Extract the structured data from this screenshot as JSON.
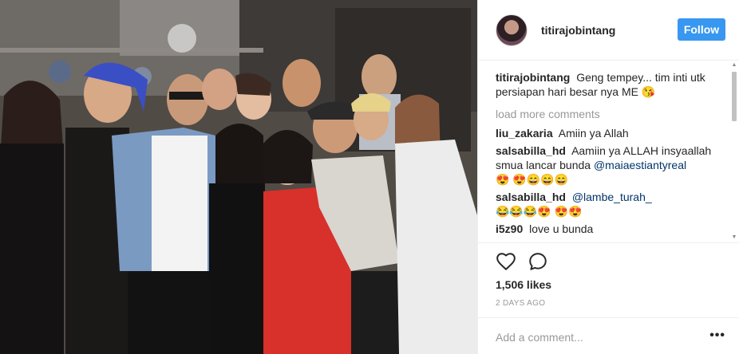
{
  "photo": {
    "description_icon": "group-photo"
  },
  "header": {
    "username": "titirajobintang",
    "follow_label": "Follow",
    "accent": "#3897f0"
  },
  "caption": {
    "user": "titirajobintang",
    "text": "Geng tempey... tim inti utk persiapan hari besar nya ME 😘"
  },
  "load_more": "load more comments",
  "comments": [
    {
      "user": "liu_zakaria",
      "text": "Amiin ya Allah",
      "mention": "",
      "emoji": ""
    },
    {
      "user": "salsabilla_hd",
      "text": "Aamiin ya ALLAH insyaallah smua lancar bunda",
      "mention": "@maiaestiantyreal",
      "emoji": "😍 😍😄😄😄"
    },
    {
      "user": "salsabilla_hd",
      "text": "",
      "mention": "@lambe_turah_",
      "emoji": "😂😂😂😍 😍😍"
    },
    {
      "user": "i5z90",
      "text": "love u bunda",
      "mention": "",
      "emoji": ""
    }
  ],
  "likes": "1,506 likes",
  "date": "2 DAYS AGO",
  "add_comment_placeholder": "Add a comment...",
  "more_label": "•••",
  "icons": {
    "like": "heart-icon",
    "comment": "comment-bubble-icon"
  }
}
